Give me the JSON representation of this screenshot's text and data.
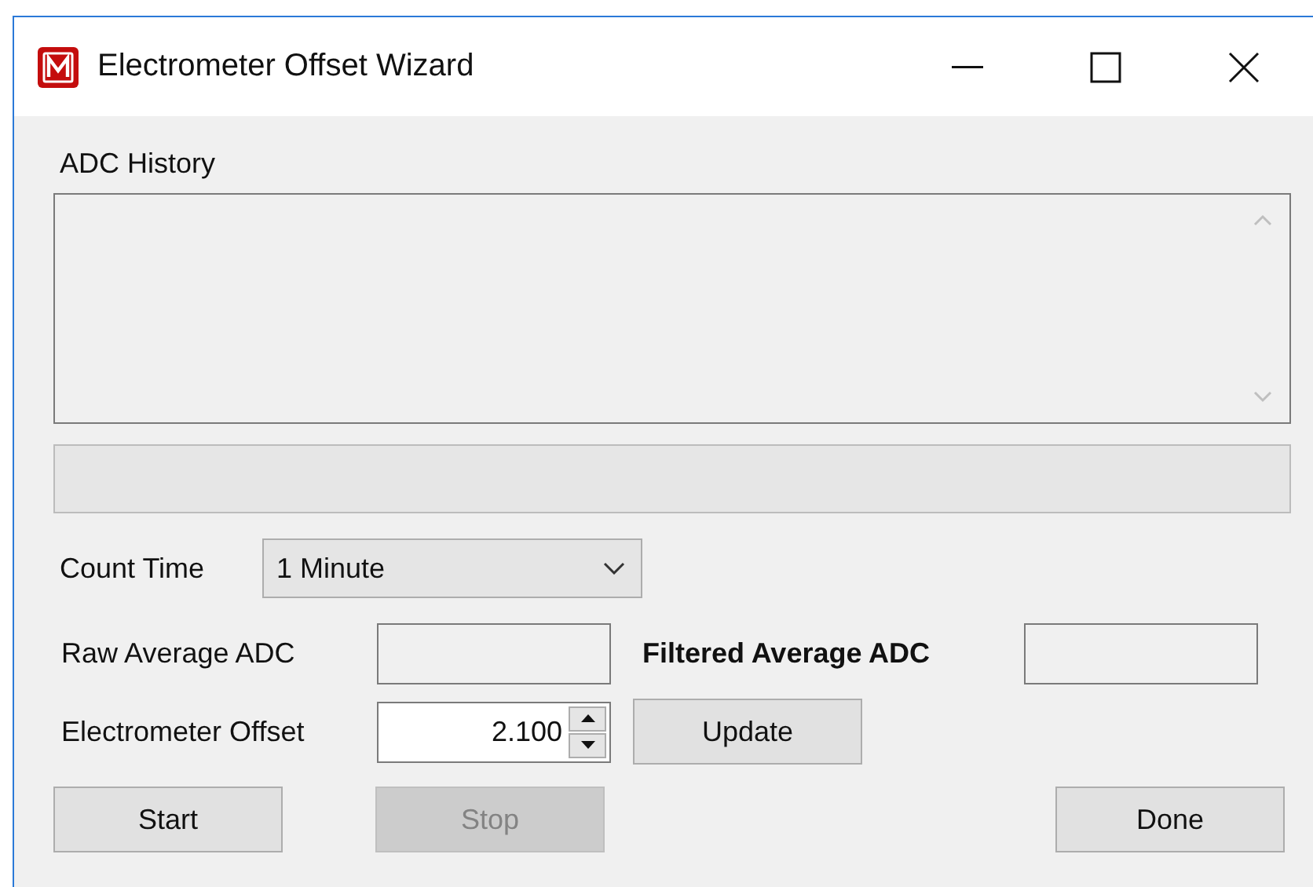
{
  "window": {
    "title": "Electrometer Offset Wizard"
  },
  "adc_history": {
    "label": "ADC History"
  },
  "count_time": {
    "label": "Count Time",
    "value": "1 Minute"
  },
  "raw_average": {
    "label": "Raw Average ADC"
  },
  "filtered_average": {
    "label": "Filtered Average ADC"
  },
  "offset": {
    "label": "Electrometer Offset",
    "value": "2.100",
    "button": "Update"
  },
  "buttons": [
    {
      "label": "Start",
      "disabled": false
    },
    {
      "label": "Stop",
      "disabled": true
    },
    {
      "label": "Done",
      "disabled": false
    }
  ]
}
